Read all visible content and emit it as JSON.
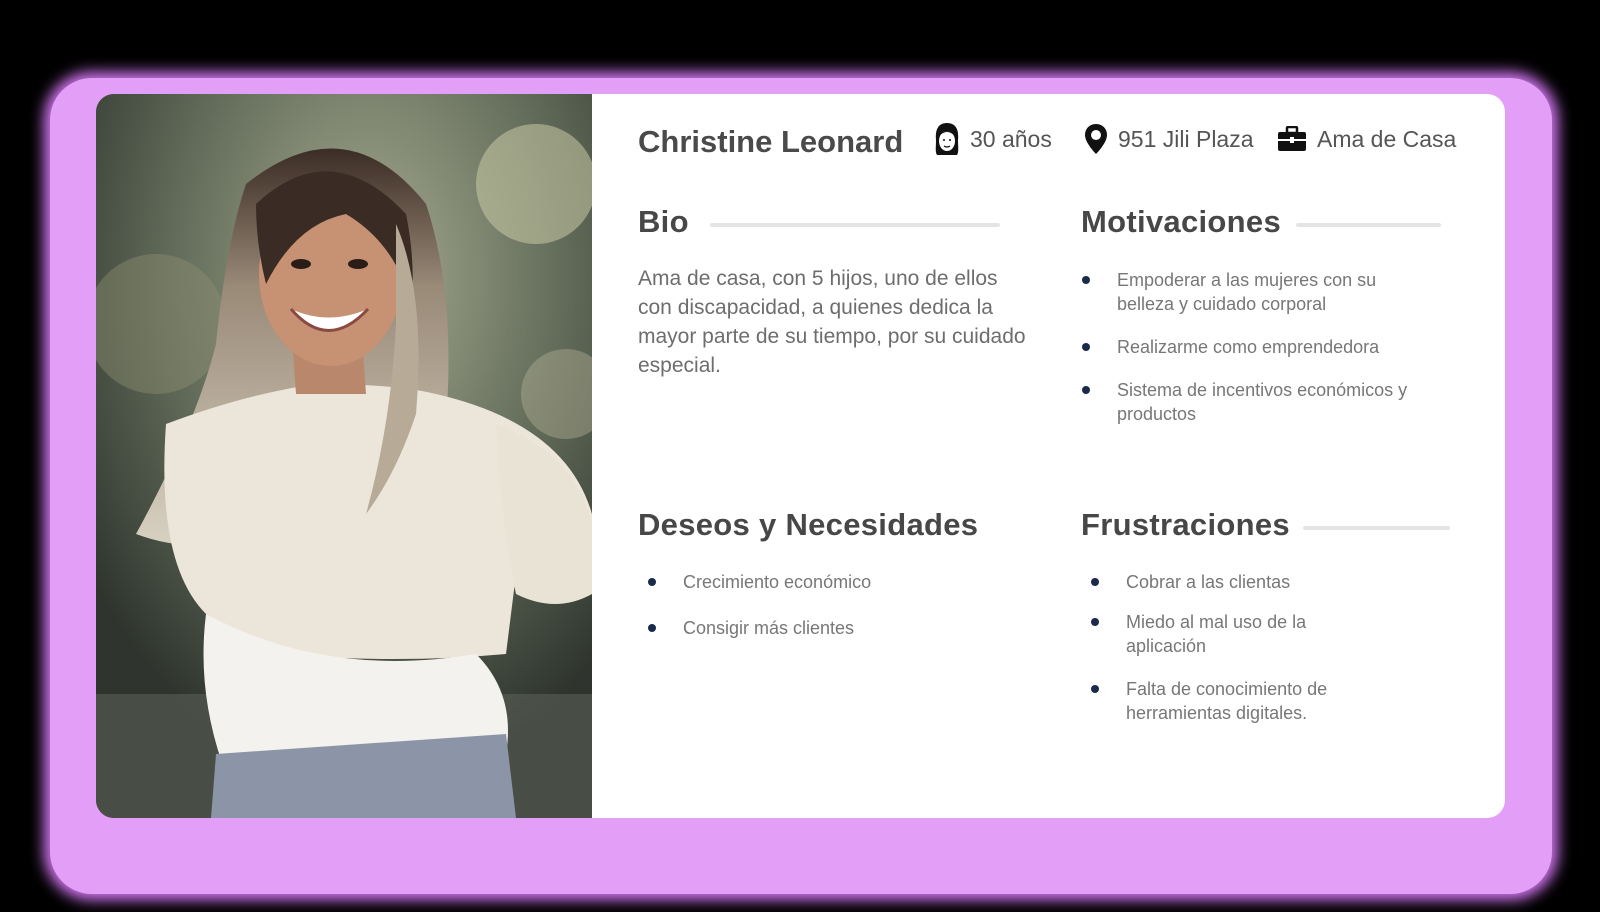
{
  "persona": {
    "name": "Christine Leonard",
    "age": "30 años",
    "location": "951 Jili Plaza",
    "occupation": "Ama de Casa"
  },
  "icons": {
    "age": "woman-face-icon",
    "location": "map-pin-icon",
    "occupation": "briefcase-icon"
  },
  "bio": {
    "title": "Bio",
    "text": "Ama de casa, con 5 hijos, uno de ellos con discapacidad, a quienes dedica la mayor parte de su tiempo, por su cuidado especial."
  },
  "motivations": {
    "title": "Motivaciones",
    "items": [
      "Empoderar a las mujeres con su belleza y cuidado corporal",
      "Realizarme como emprendedora",
      "Sistema de incentivos económicos y productos"
    ]
  },
  "needs": {
    "title": "Deseos y Necesidades",
    "items": [
      "Crecimiento económico",
      "Consigir más clientes"
    ]
  },
  "frustrations": {
    "title": "Frustraciones",
    "items": [
      "Cobrar a las clientas",
      "Miedo al mal uso de la aplicación",
      "Falta de conocimiento de herramientas digitales."
    ]
  },
  "colors": {
    "glow": "#e39ef7",
    "card": "#ffffff",
    "heading": "#474747",
    "body_text": "#6d6d6d",
    "bullet": "#1b2a4a"
  }
}
